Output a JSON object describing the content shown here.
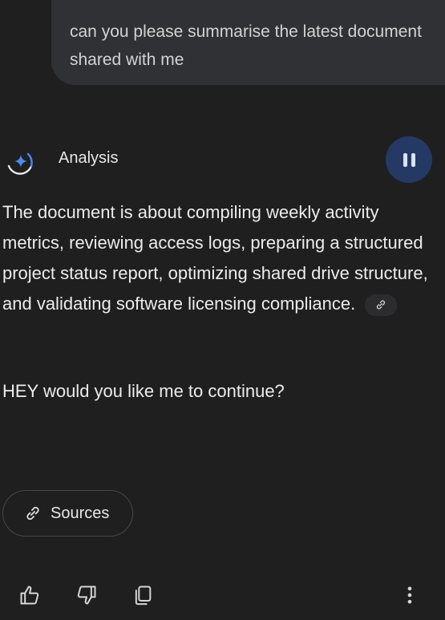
{
  "user_message": {
    "text": "can you please summarise the latest document shared with me"
  },
  "response": {
    "header_label": "Analysis",
    "status": "pause-icon",
    "body": "The document is about compiling weekly activity metrics, reviewing access logs, preparing a structured project status report, optimizing shared drive structure, and validating software licensing compliance.",
    "followup": "HEY would you like me to continue?",
    "sources_label": "Sources"
  },
  "actions": [
    "thumbs-up-icon",
    "thumbs-down-icon",
    "copy-icon",
    "more-vertical-icon"
  ],
  "colors": {
    "background": "#1f1f20",
    "user_bubble": "#303134",
    "pause_button": "#243a64",
    "accent_blue": "#4a8af4"
  }
}
